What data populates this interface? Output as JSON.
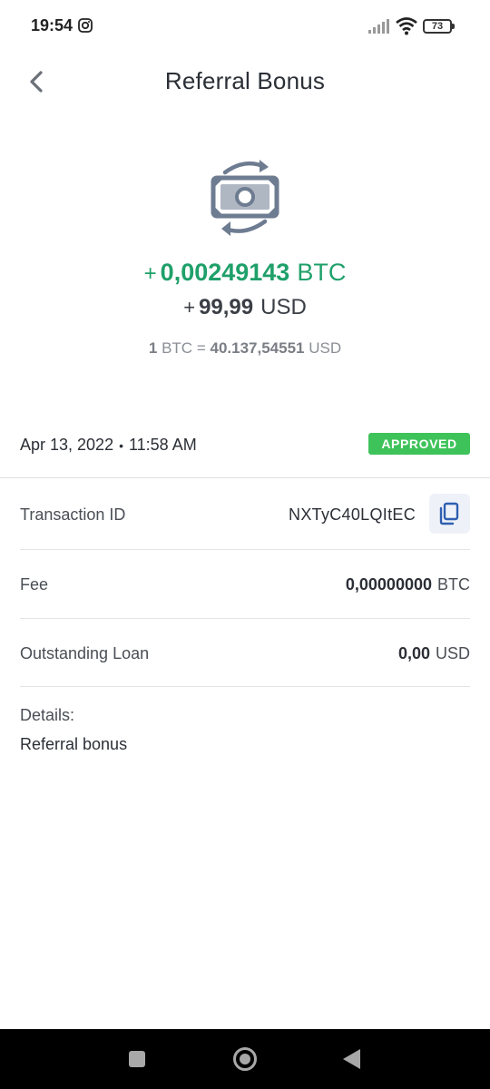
{
  "status_bar": {
    "time": "19:54",
    "battery": "73"
  },
  "header": {
    "title": "Referral Bonus",
    "back_icon": "chevron-left-icon"
  },
  "transaction": {
    "icon": "money-exchange-icon",
    "crypto_sign": "+",
    "crypto_amount": "0,00249143",
    "crypto_unit": "BTC",
    "fiat_sign": "+",
    "fiat_amount": "99,99",
    "fiat_unit": "USD",
    "rate_qty": "1",
    "rate_from": "BTC",
    "rate_eq": "=",
    "rate_value": "40.137,54551",
    "rate_to": "USD",
    "date": "Apr 13, 2022",
    "separator": "•",
    "time": "11:58 AM",
    "status": "APPROVED"
  },
  "rows": {
    "txid_label": "Transaction ID",
    "txid_value": "NXTyC40LQItEC",
    "fee_label": "Fee",
    "fee_value": "0,00000000",
    "fee_unit": "BTC",
    "loan_label": "Outstanding Loan",
    "loan_value": "0,00",
    "loan_unit": "USD",
    "details_label": "Details:",
    "details_value": "Referral bonus"
  },
  "colors": {
    "positive": "#1fa06a",
    "approved_badge": "#3ec35a",
    "copy_bg": "#eef2f8",
    "icon": "#6e7c91"
  }
}
